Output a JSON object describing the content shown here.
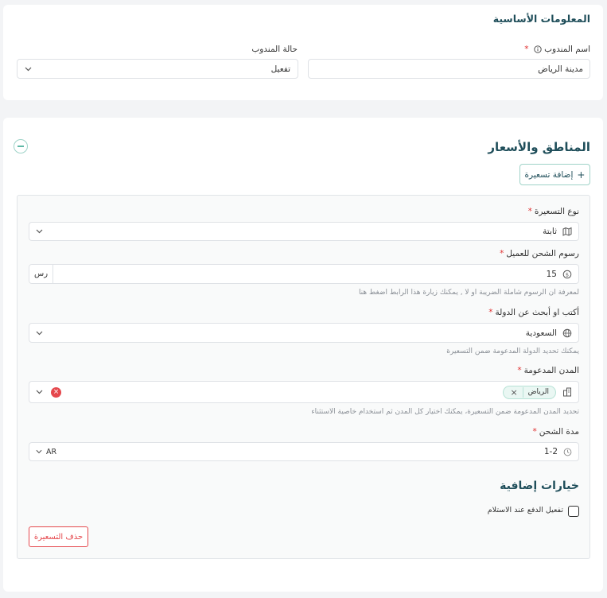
{
  "basic_info": {
    "title": "المعلومات الأساسية",
    "rep_name_label": "اسم المندوب",
    "rep_name_value": "مدينة الرياض",
    "rep_status_label": "حالة المندوب",
    "rep_status_value": "تفعيل"
  },
  "regions": {
    "title": "المناطق والأسعار",
    "add_pricing_label": "إضافة تسعيرة",
    "pricing_type": {
      "label": "نوع التسعيرة",
      "value": "ثابتة"
    },
    "shipping_fee": {
      "label": "رسوم الشحن للعميل",
      "value": "15",
      "currency": "رس",
      "hint": "لمعرفة ان الرسوم شاملة الضريبة او لا , يمكنك زيارة هذا الرابط اضغط هنا"
    },
    "country": {
      "label": "أكتب او أبحث عن الدولة",
      "value": "السعودية",
      "hint": "يمكنك تحديد الدولة المدعومة ضمن التسعيرة"
    },
    "cities": {
      "label": "المدن المدعومة",
      "chips": [
        "الرياض"
      ],
      "hint": "تحديد المدن المدعومة ضمن التسعيرة، يمكنك اختيار كل المدن ثم استخدام خاصية الاستثناء"
    },
    "shipping_duration": {
      "label": "مدة الشحن",
      "value": "1-2",
      "unit": "AR"
    },
    "extra_options": {
      "title": "خيارات إضافية",
      "cod_label": "تفعيل الدفع عند الاستلام",
      "cod_checked": false
    },
    "delete_pricing_label": "حذف التسعيرة"
  }
}
